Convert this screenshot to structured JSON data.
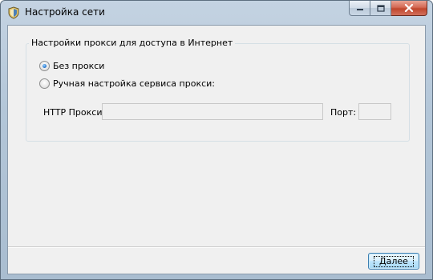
{
  "window": {
    "title": "Настройка сети",
    "app_icon": "network-shield-icon"
  },
  "caption_buttons": {
    "minimize_icon": "minimize-icon",
    "maximize_icon": "maximize-icon",
    "close_icon": "close-icon"
  },
  "proxy_group": {
    "title": "Настройки прокси для доступа в Интернет",
    "options": [
      {
        "label": "Без прокси",
        "selected": true
      },
      {
        "label": "Ручная настройка сервиса прокси:",
        "selected": false
      }
    ],
    "http_proxy": {
      "label": "HTTP Прокси:",
      "value": ""
    },
    "port": {
      "label": "Порт:",
      "value": ""
    }
  },
  "footer": {
    "next_label": "Далее"
  },
  "colors": {
    "title_bar": "#b3c6d8",
    "client_bg": "#f0f0f0",
    "close_button": "#c0462d",
    "radio_selected": "#2a7bd1",
    "button_border": "#3c7fb1"
  }
}
